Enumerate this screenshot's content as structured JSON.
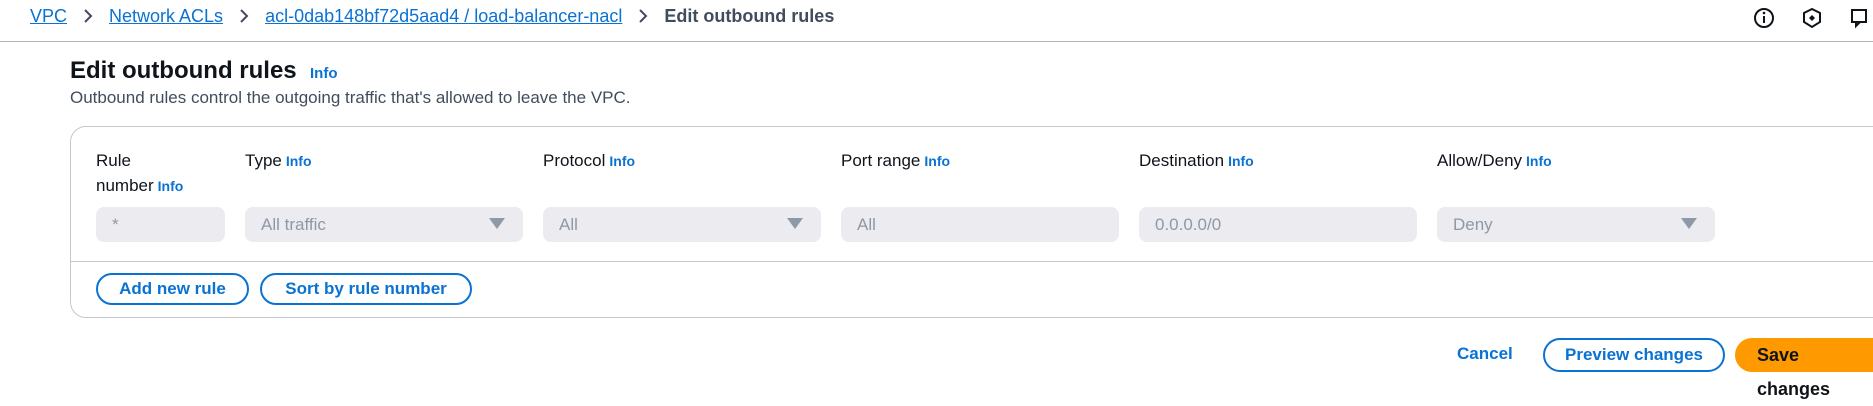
{
  "breadcrumb": {
    "items": [
      "VPC",
      "Network ACLs",
      "acl-0dab148bf72d5aad4 / load-balancer-nacl"
    ],
    "current": "Edit outbound rules"
  },
  "header": {
    "icons": [
      "info-circle-icon",
      "shield-icon",
      "feedback-icon"
    ]
  },
  "page": {
    "title": "Edit outbound rules",
    "title_info": "Info",
    "description": "Outbound rules control the outgoing traffic that's allowed to leave the VPC."
  },
  "rules_table": {
    "columns": [
      {
        "label_line1": "Rule",
        "label_line2": "number",
        "info": "Info"
      },
      {
        "label": "Type",
        "info": "Info"
      },
      {
        "label": "Protocol",
        "info": "Info"
      },
      {
        "label": "Port range",
        "info": "Info"
      },
      {
        "label": "Destination",
        "info": "Info"
      },
      {
        "label": "Allow/Deny",
        "info": "Info"
      }
    ],
    "row": {
      "rule_number_placeholder": "*",
      "type": "All traffic",
      "protocol": "All",
      "port_range": "All",
      "destination": "0.0.0.0/0",
      "allow_deny": "Deny"
    },
    "buttons": {
      "add_new_rule": "Add new rule",
      "sort_by_rule_number": "Sort by rule number"
    }
  },
  "footer": {
    "cancel": "Cancel",
    "preview_changes": "Preview changes",
    "save_changes": "Save changes"
  },
  "colors": {
    "link": "#0972d3",
    "primary_button": "#ff9900",
    "disabled_field": "#ebebf0",
    "border": "#c6c6cd"
  }
}
